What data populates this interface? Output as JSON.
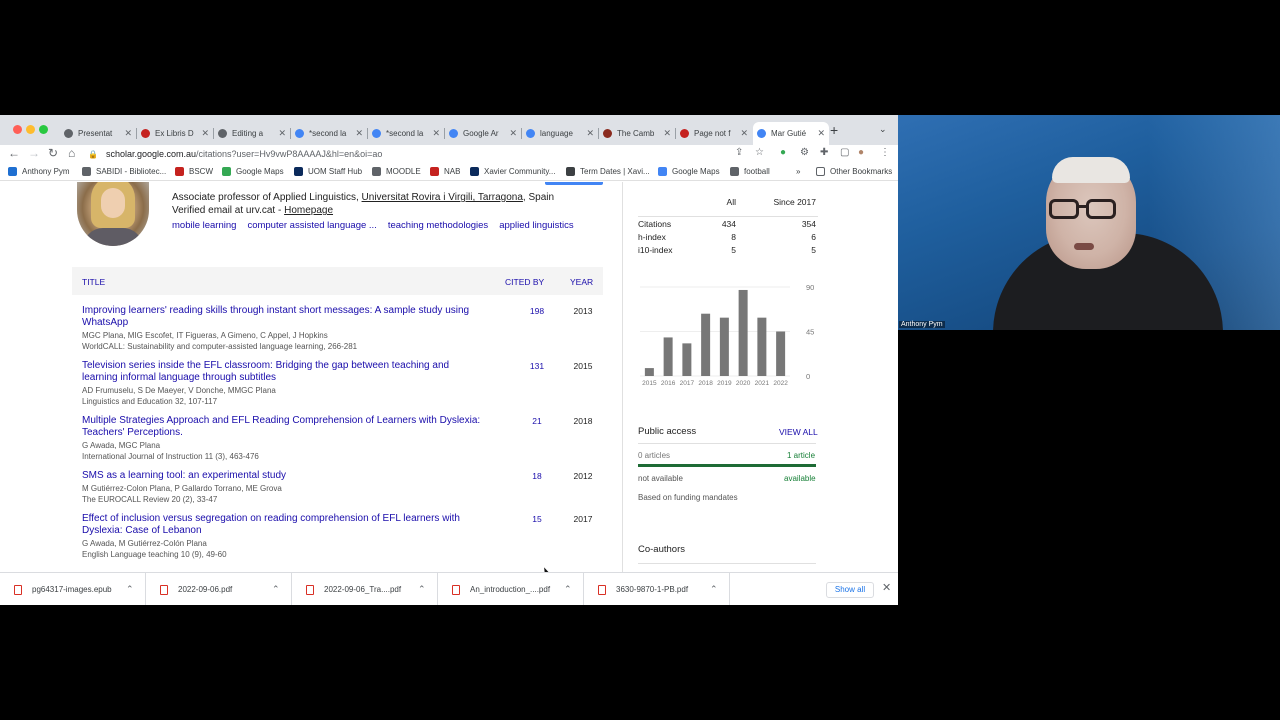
{
  "browser": {
    "tabs": [
      {
        "label": "Presentat",
        "icon": "globe-icon",
        "color": "#5f6368"
      },
      {
        "label": "Ex Libris D",
        "icon": "exlibris-icon",
        "color": "#c5221f"
      },
      {
        "label": "Editing a",
        "icon": "globe-icon",
        "color": "#5f6368"
      },
      {
        "label": "*second la",
        "icon": "diamond-icon",
        "color": "#4285f4"
      },
      {
        "label": "*second la",
        "icon": "google-icon",
        "color": "#4285f4"
      },
      {
        "label": "Google Ar",
        "icon": "google-icon",
        "color": "#4285f4"
      },
      {
        "label": "language",
        "icon": "google-icon",
        "color": "#4285f4"
      },
      {
        "label": "The Camb",
        "icon": "shield-icon",
        "color": "#8a2a1e"
      },
      {
        "label": "Page not f",
        "icon": "exlibris-icon",
        "color": "#c5221f"
      },
      {
        "label": "Mar Gutié",
        "icon": "scholar-icon",
        "color": "#4285f4"
      }
    ],
    "url_host": "scholar.google.com.au",
    "url_path": "/citations?user=Hv9vwP8AAAAJ&hl=en&oi=ao",
    "bookmarks": [
      {
        "label": "Anthony Pym",
        "icon": "trello-icon",
        "color": "#1f6fd1"
      },
      {
        "label": "SABIDI - Bibliotec...",
        "icon": "globe-icon",
        "color": "#5f6368"
      },
      {
        "label": "BSCW",
        "icon": "bscw-icon",
        "color": "#c5221f"
      },
      {
        "label": "Google Maps",
        "icon": "maps-pin-icon",
        "color": "#34a853"
      },
      {
        "label": "UOM Staff Hub",
        "icon": "uom-icon",
        "color": "#0b2a5b"
      },
      {
        "label": "MOODLE",
        "icon": "globe-icon",
        "color": "#5f6368"
      },
      {
        "label": "NAB",
        "icon": "nab-icon",
        "color": "#c5221f"
      },
      {
        "label": "Xavier Community...",
        "icon": "xavier-icon",
        "color": "#0b2a5b"
      },
      {
        "label": "Term Dates | Xavi...",
        "icon": "calendar-icon",
        "color": "#3c4043"
      },
      {
        "label": "Google Maps",
        "icon": "google-icon",
        "color": "#4285f4"
      },
      {
        "label": "football",
        "icon": "globe-icon",
        "color": "#5f6368"
      }
    ],
    "overflow_label": "»",
    "other_bookmarks": "Other Bookmarks"
  },
  "profile": {
    "affiliation_prefix": "Associate professor of Applied Linguistics, ",
    "affiliation_link": "Universitat Rovira i Virgili, Tarragona",
    "affiliation_suffix": ", Spain",
    "email_text": "Verified email at urv.cat - ",
    "homepage": "Homepage",
    "interests": [
      "mobile learning",
      "computer assisted language ...",
      "teaching methodologies",
      "applied linguistics"
    ]
  },
  "table": {
    "col_title": "TITLE",
    "col_cited": "CITED BY",
    "col_year": "YEAR",
    "rows": [
      {
        "title": "Improving learners' reading skills through instant short messages: A sample study using WhatsApp",
        "authors": "MGC Plana, MIG Escofet, IT Figueras, A Gimeno, C Appel, J Hopkins",
        "venue": "WorldCALL: Sustainability and computer-assisted language learning, 266-281",
        "cited": "198",
        "year": "2013"
      },
      {
        "title": "Television series inside the EFL classroom: Bridging the gap between teaching and learning informal language through subtitles",
        "authors": "AD Frumuselu, S De Maeyer, V Donche, MMGC Plana",
        "venue": "Linguistics and Education 32, 107-117",
        "cited": "131",
        "year": "2015"
      },
      {
        "title": "Multiple Strategies Approach and EFL Reading Comprehension of Learners with Dyslexia: Teachers' Perceptions.",
        "authors": "G Awada, MGC Plana",
        "venue": "International Journal of Instruction 11 (3), 463-476",
        "cited": "21",
        "year": "2018"
      },
      {
        "title": "SMS as a learning tool: an experimental study",
        "authors": "M Gutiérrez-Colon Plana, P Gallardo Torrano, ME Grova",
        "venue": "The EUROCALL Review 20 (2), 33-47",
        "cited": "18",
        "year": "2012"
      },
      {
        "title": "Effect of inclusion versus segregation on reading comprehension of EFL learners with Dyslexia: Case of Lebanon",
        "authors": "G Awada, M Gutiérrez-Colón Plana",
        "venue": "English Language teaching 10 (9), 49-60",
        "cited": "15",
        "year": "2017"
      }
    ]
  },
  "citations": {
    "head_all": "All",
    "head_since": "Since 2017",
    "rows": [
      {
        "label": "Citations",
        "all": "434",
        "since": "354"
      },
      {
        "label": "h-index",
        "all": "8",
        "since": "6"
      },
      {
        "label": "i10-index",
        "all": "5",
        "since": "5"
      }
    ]
  },
  "chart_data": {
    "type": "bar",
    "categories": [
      "2015",
      "2016",
      "2017",
      "2018",
      "2019",
      "2020",
      "2021",
      "2022"
    ],
    "values": [
      8,
      39,
      33,
      63,
      59,
      87,
      59,
      45
    ],
    "ylim": [
      0,
      90
    ],
    "yticks": [
      "90",
      "45",
      "0"
    ],
    "bar_color": "#777777"
  },
  "public_access": {
    "title": "Public access",
    "view_all": "VIEW ALL",
    "not_available_count": "0 articles",
    "available_count": "1 article",
    "available_fraction": 1.0,
    "not_available_label": "not available",
    "available_label": "available",
    "note": "Based on funding mandates"
  },
  "coauthors": {
    "title": "Co-authors"
  },
  "downloads": {
    "files": [
      "pg64317-images.epub",
      "2022-09-06.pdf",
      "2022-09-06_Tra....pdf",
      "An_introduction_....pdf",
      "3630-9870-1-PB.pdf"
    ],
    "show_all": "Show all"
  },
  "webcam": {
    "name": "Anthony Pym"
  }
}
